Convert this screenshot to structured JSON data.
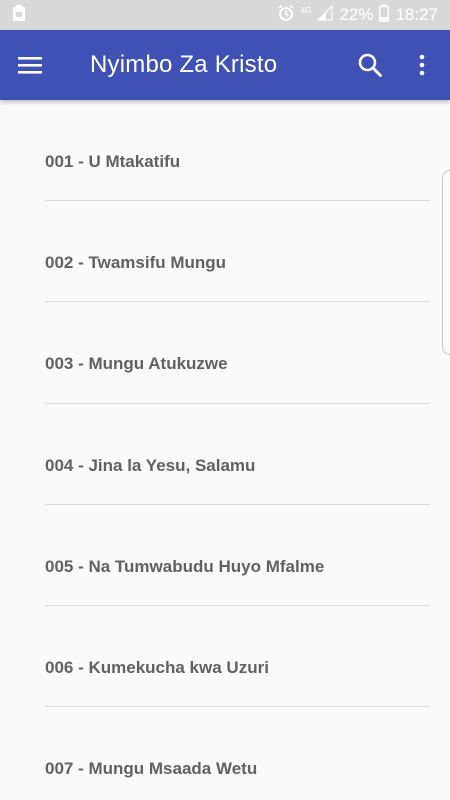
{
  "status_bar": {
    "network": "4G",
    "battery": "22%",
    "time": "18:27"
  },
  "app_bar": {
    "title": "Nyimbo Za Kristo",
    "background": "#3f51b5"
  },
  "songs": [
    "001 - U Mtakatifu",
    "002 - Twamsifu Mungu",
    "003 - Mungu Atukuzwe",
    "004 - Jina la Yesu, Salamu",
    "005 - Na Tumwabudu Huyo Mfalme",
    "006 - Kumekucha kwa Uzuri",
    "007 - Mungu Msaada Wetu"
  ]
}
